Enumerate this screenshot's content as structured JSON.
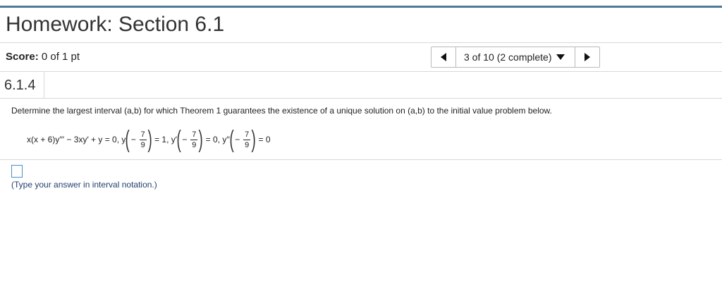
{
  "page": {
    "title": "Homework: Section 6.1"
  },
  "score": {
    "label": "Score:",
    "value": "0 of 1 pt"
  },
  "navigator": {
    "position_text": "3 of 10 (2 complete)"
  },
  "question": {
    "number": "6.1.4",
    "prompt": "Determine the largest interval (a,b) for which Theorem 1 guarantees the existence of a unique solution on (a,b) to the initial value problem below.",
    "equation": {
      "de": "x(x + 6)y′′′ − 3xy′ + y = 0, y",
      "frac_num": "7",
      "frac_den": "9",
      "ic1_tail": "= 1, y′",
      "ic2_tail": "= 0, y′′",
      "ic3_tail": "= 0",
      "minus": "−"
    },
    "answer_hint": "(Type your answer in interval notation.)"
  },
  "colors": {
    "top_bar": "#4a7a96",
    "hint_text": "#223f6f",
    "input_border": "#4a90c8"
  }
}
